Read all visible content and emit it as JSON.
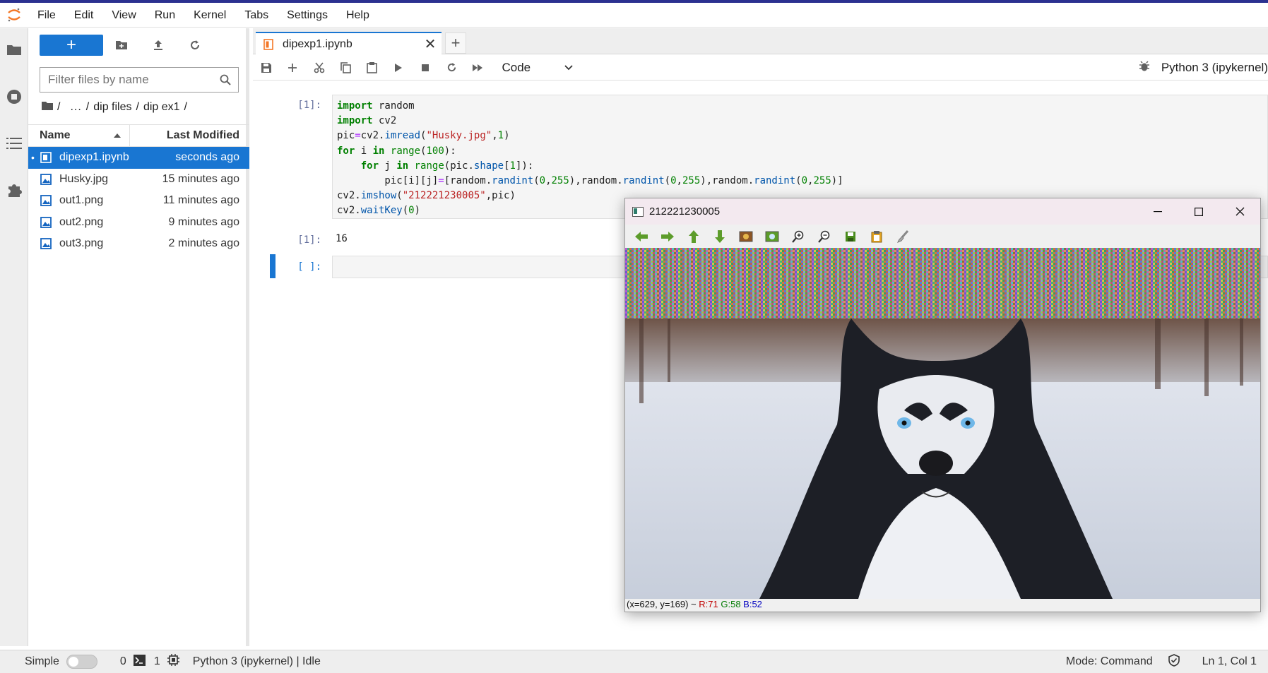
{
  "menu": [
    "File",
    "Edit",
    "View",
    "Run",
    "Kernel",
    "Tabs",
    "Settings",
    "Help"
  ],
  "filebrowser": {
    "new_label": "+",
    "search_placeholder": "Filter files by name",
    "breadcrumb": [
      "/",
      "...",
      "/",
      "dip files",
      "/",
      "dip ex1",
      "/"
    ],
    "columns": {
      "name": "Name",
      "modified": "Last Modified"
    },
    "files": [
      {
        "name": "dipexp1.ipynb",
        "modified": "seconds ago",
        "selected": true
      },
      {
        "name": "Husky.jpg",
        "modified": "15 minutes ago"
      },
      {
        "name": "out1.png",
        "modified": "11 minutes ago"
      },
      {
        "name": "out2.png",
        "modified": "9 minutes ago"
      },
      {
        "name": "out3.png",
        "modified": "2 minutes ago"
      }
    ]
  },
  "tab": {
    "title": "dipexp1.ipynb",
    "close": "✕",
    "add": "+"
  },
  "toolbar": {
    "cell_type": "Code",
    "kernel": "Python 3 (ipykernel)"
  },
  "cells": {
    "prompt_1": "[1]:",
    "output_prompt": "[1]:",
    "output_value": "16",
    "prompt_empty": "[ ]:"
  },
  "status": {
    "simple_label": "Simple",
    "count_a": "0",
    "count_b": "1",
    "kernel_status": "Python 3 (ipykernel) | Idle",
    "mode": "Mode: Command",
    "cursor": "Ln 1, Col 1"
  },
  "cv_window": {
    "title": "212221230005",
    "status_prefix": "(x=629, y=169) ~ ",
    "r": "R:71",
    "g": "G:58",
    "b": "B:52"
  },
  "colors": {
    "accent": "#1976d2",
    "top_line": "#2b3190"
  }
}
